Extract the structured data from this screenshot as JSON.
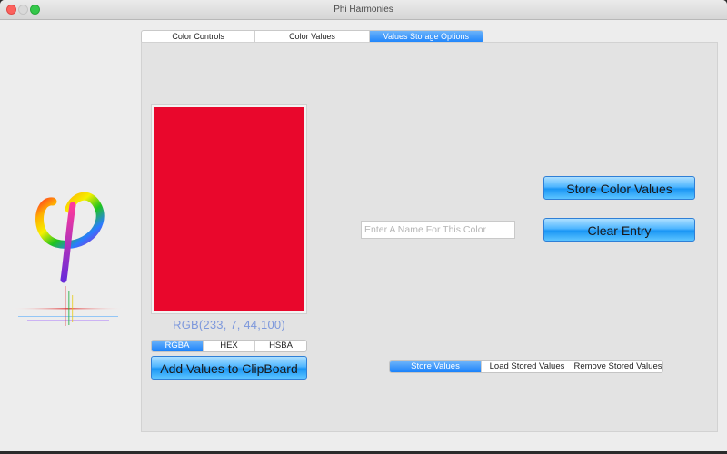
{
  "window": {
    "title": "Phi Harmonies"
  },
  "tabs": [
    {
      "label": "Color Controls",
      "active": false
    },
    {
      "label": "Color Values",
      "active": false
    },
    {
      "label": "Values Storage Options",
      "active": true
    }
  ],
  "swatch": {
    "color": "#e9072c"
  },
  "rgb_text": "RGB(233,  7, 44,100)",
  "format_segments": [
    {
      "label": "RGBA",
      "active": true
    },
    {
      "label": "HEX",
      "active": false
    },
    {
      "label": "HSBA",
      "active": false
    }
  ],
  "buttons": {
    "add_to_clipboard": "Add Values to ClipBoard",
    "store_color_values": "Store Color Values",
    "clear_entry": "Clear Entry"
  },
  "name_input": {
    "value": "",
    "placeholder": "Enter A Name For This Color"
  },
  "storage_segments": [
    {
      "label": "Store Values",
      "active": true
    },
    {
      "label": "Load Stored Values",
      "active": false
    },
    {
      "label": "Remove Stored Values",
      "active": false
    }
  ],
  "colors": {
    "accent": "#1a82fb",
    "rgb_text": "#7d98dc"
  },
  "icons": {
    "logo": "phi-logo-icon"
  }
}
